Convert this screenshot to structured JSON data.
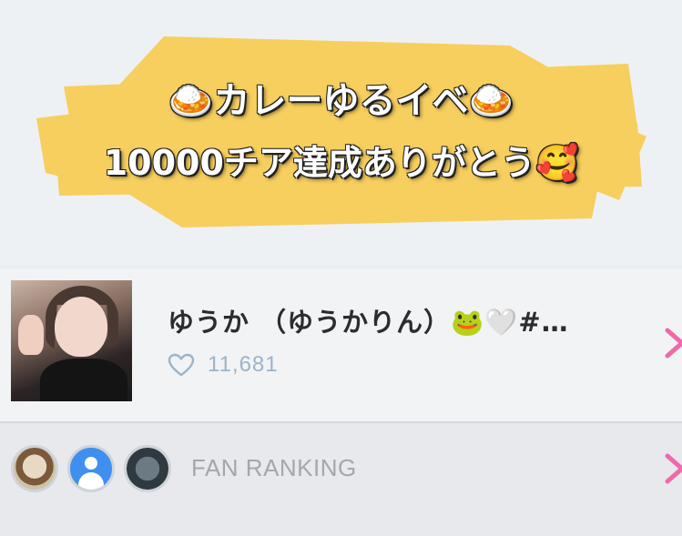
{
  "banner": {
    "line1": "🍛カレーゆるイベ🍛",
    "line2": "10000チア達成ありがとう🥰",
    "highlight_color": "#f7cf5e"
  },
  "profile": {
    "name": "ゆうか （ゆうかりん）🐸🤍#…",
    "likes_count": "11,681",
    "like_icon": "heart-outline-icon",
    "avatar_alt": "profile photo"
  },
  "ranking": {
    "label": "FAN RANKING",
    "avatars": [
      "fan-avatar-1",
      "fan-avatar-default",
      "fan-avatar-3"
    ]
  },
  "colors": {
    "chevron": "#ee6aa8",
    "likes_text": "#9cb4c8"
  }
}
